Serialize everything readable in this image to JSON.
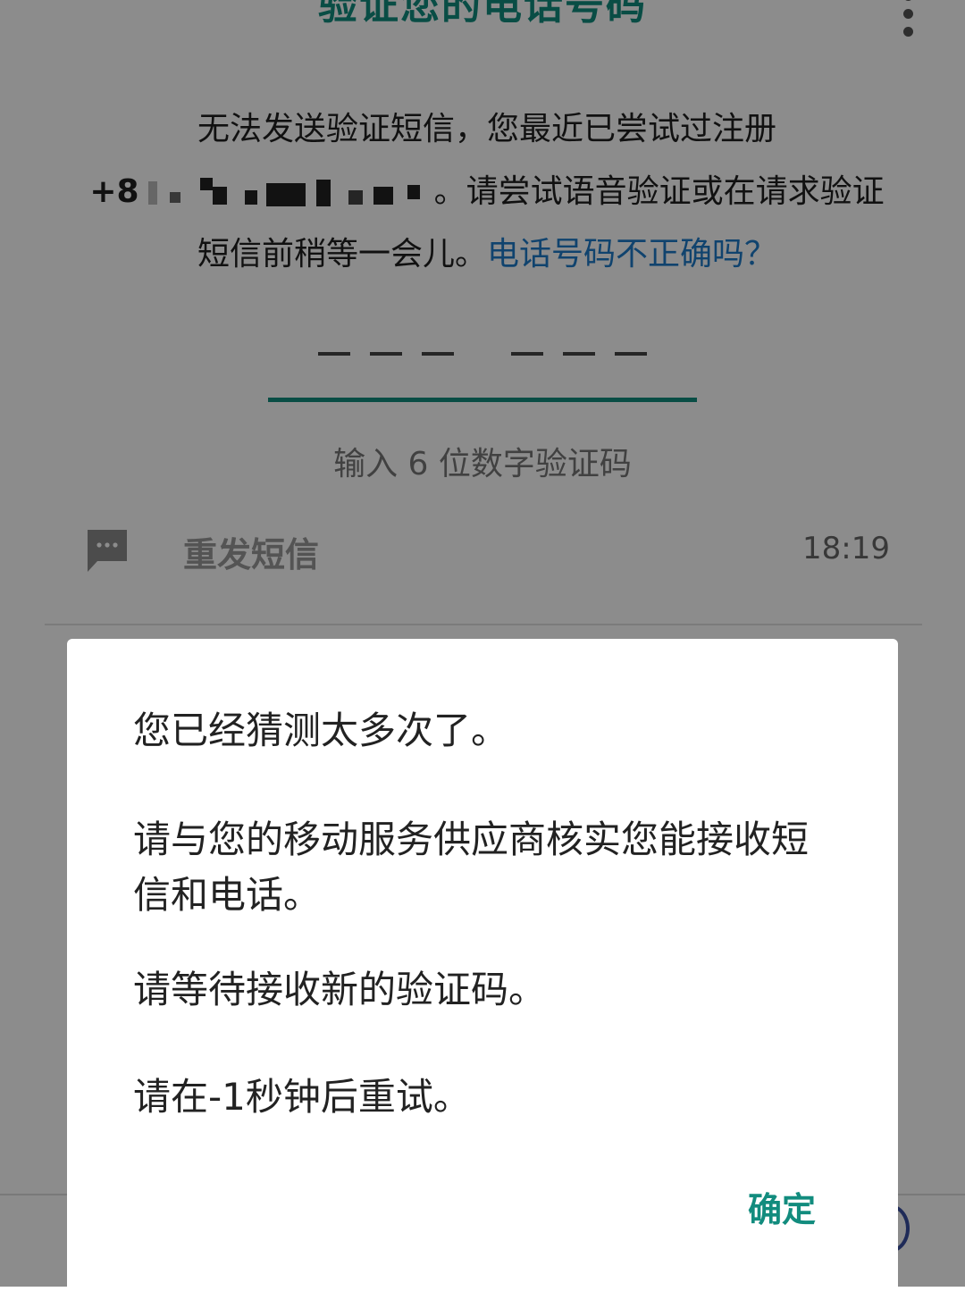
{
  "header": {
    "title": "验证您的电话号码",
    "menu_icon": "more-vert-icon"
  },
  "description": {
    "line1": "无法发送验证短信，您最近已尝试过注册",
    "phone_prefix": "+8",
    "line2": "。请尝试语音验证或在请求验证",
    "line3": "短信前稍等一会儿。",
    "wrong_number_link": "电话号码不正确吗？"
  },
  "code_input": {
    "hint": "输入 6 位数字验证码",
    "accent_color": "#128c7e"
  },
  "resend": {
    "icon": "message-icon",
    "label": "重发短信",
    "timer": "18:19"
  },
  "dialog": {
    "message1": "您已经猜测太多次了。",
    "message2": "请与您的移动服务供应商核实您能接收短信和电话。",
    "message3": "请等待接收新的验证码。",
    "message4": "请在-1秒钟后重试。",
    "ok_label": "确定"
  }
}
